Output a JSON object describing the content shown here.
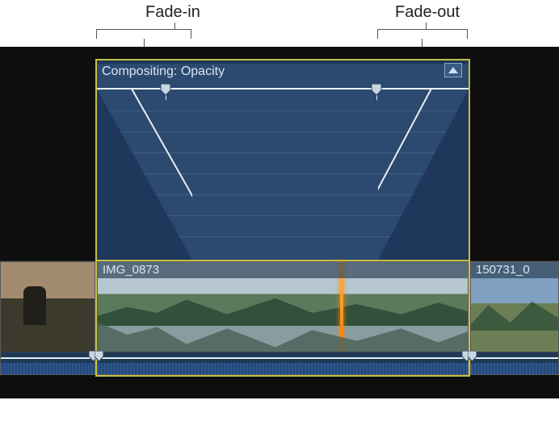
{
  "callouts": {
    "fade_in": "Fade-in",
    "fade_out": "Fade-out"
  },
  "animation_panel": {
    "title": "Compositing: Opacity",
    "dropdown_icon_name": "animation-menu-icon"
  },
  "clips": {
    "left_neighbor": {
      "name": ""
    },
    "selected": {
      "name": "IMG_0873"
    },
    "right_neighbor": {
      "name": "150731_0"
    }
  }
}
